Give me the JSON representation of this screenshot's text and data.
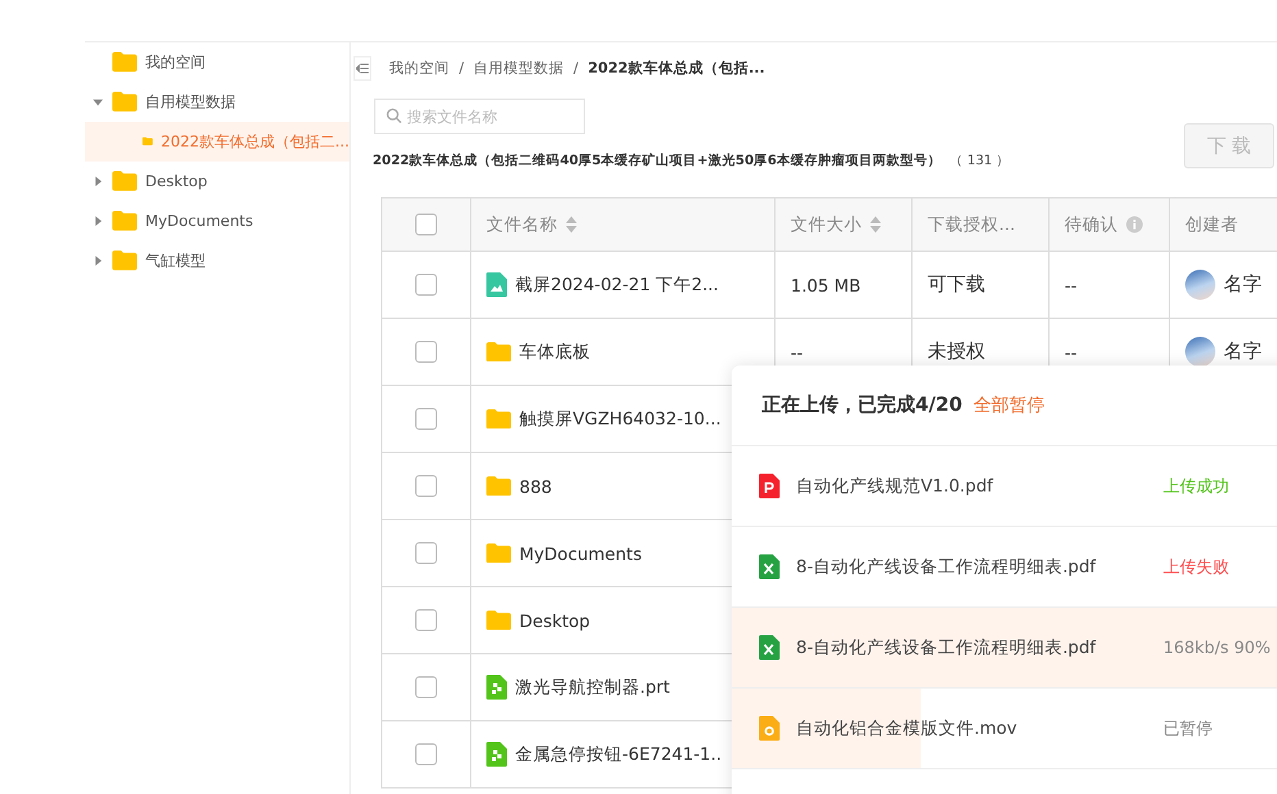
{
  "sidebar": {
    "tree": [
      {
        "label": "我的空间",
        "selected": false
      },
      {
        "label": "自用模型数据",
        "selected": false,
        "expanded": true,
        "children": [
          {
            "label": "2022款车体总成（包括二...",
            "selected": true
          }
        ]
      },
      {
        "label": "Desktop",
        "selected": false,
        "expanded": false
      },
      {
        "label": "MyDocuments",
        "selected": false,
        "expanded": false
      },
      {
        "label": "气缸模型",
        "selected": false,
        "expanded": false
      }
    ]
  },
  "breadcrumb": [
    "我的空间",
    "自用模型数据",
    "2022款车体总成（包括..."
  ],
  "breadcrumb_separator": "/",
  "search": {
    "placeholder": "搜索文件名称"
  },
  "folder_title": "2022款车体总成（包括二维码40厚5本缓存矿山项目+激光50厚6本缓存肿瘤项目两款型号）",
  "folder_count": "（ 131 ）",
  "download_button": {
    "label": "下 载",
    "disabled": true
  },
  "table": {
    "columns": [
      {
        "label": "文件名称",
        "sortable": true,
        "info": false
      },
      {
        "label": "文件大小",
        "sortable": true,
        "info": false
      },
      {
        "label": "下载授权...",
        "sortable": false,
        "info": false
      },
      {
        "label": "待确认",
        "sortable": false,
        "info": true
      },
      {
        "label": "创建者",
        "sortable": false,
        "info": false
      }
    ],
    "header_checked": false,
    "rows": [
      {
        "kind": "image",
        "name": "截屏2024-02-21 下午2...",
        "size": "1.05 MB",
        "auth": "可下载",
        "pending": "--",
        "creator": "名字",
        "checked": false
      },
      {
        "kind": "folder",
        "name": "车体底板",
        "size": "--",
        "auth": "未授权",
        "pending": "--",
        "creator": "名字",
        "checked": false
      },
      {
        "kind": "folder",
        "name": "触摸屏VGZH64032-10...",
        "checked": false
      },
      {
        "kind": "folder",
        "name": "888",
        "checked": false
      },
      {
        "kind": "folder",
        "name": "MyDocuments",
        "checked": false
      },
      {
        "kind": "folder",
        "name": "Desktop",
        "checked": false
      },
      {
        "kind": "model",
        "name": "激光导航控制器.prt",
        "checked": false
      },
      {
        "kind": "model",
        "name": "金属急停按钮-6E7241-1..",
        "checked": false
      }
    ]
  },
  "upload_panel": {
    "title": "正在上传，已完成4/20",
    "action": "全部暂停",
    "items": [
      {
        "kind": "pdf",
        "name": "自动化产线规范V1.0.pdf",
        "status": "上传成功",
        "color": "#52c41a"
      },
      {
        "kind": "excel",
        "name": "8-自动化产线设备工作流程明细表.pdf",
        "status": "上传失败",
        "color": "#ff4d4f"
      },
      {
        "kind": "excel",
        "name": "8-自动化产线设备工作流程明细表.pdf",
        "status": "168kb/s 90%",
        "color": "#888888",
        "level": 0.9
      },
      {
        "kind": "video",
        "name": "自动化铝合金模版文件.mov",
        "status": "已暂停",
        "color": "#888888",
        "level": 0.3
      }
    ]
  }
}
